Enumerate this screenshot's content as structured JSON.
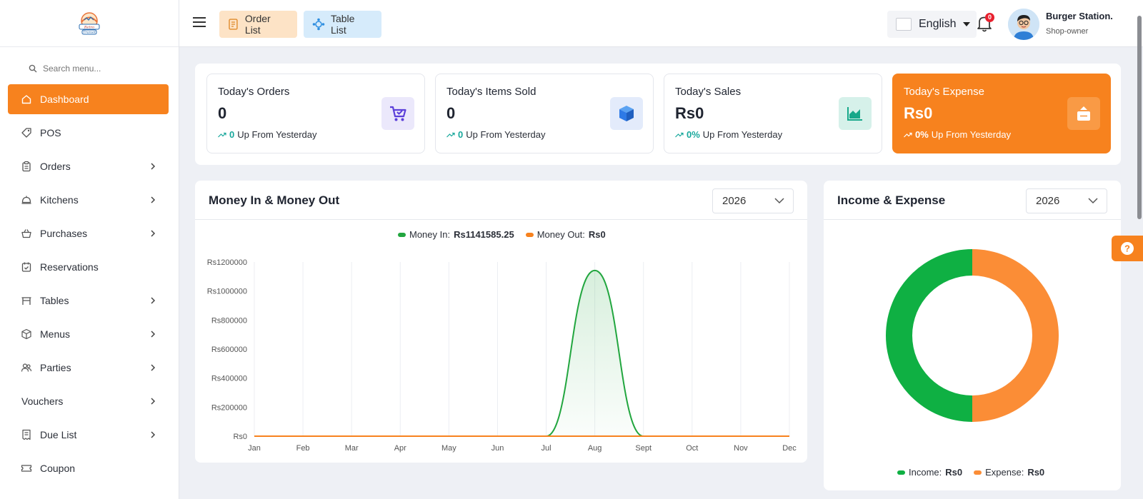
{
  "brand": {
    "logo_text": "Retro Transit"
  },
  "sidebar": {
    "search_placeholder": "Search menu...",
    "items": [
      {
        "label": "Dashboard",
        "icon": "home-icon",
        "active": true,
        "has_children": false
      },
      {
        "label": "POS",
        "icon": "tag-icon",
        "has_children": false
      },
      {
        "label": "Orders",
        "icon": "clipboard-icon",
        "has_children": true
      },
      {
        "label": "Kitchens",
        "icon": "cloche-icon",
        "has_children": true
      },
      {
        "label": "Purchases",
        "icon": "basket-icon",
        "has_children": true
      },
      {
        "label": "Reservations",
        "icon": "calendar-check-icon",
        "has_children": false
      },
      {
        "label": "Tables",
        "icon": "table-icon",
        "has_children": true
      },
      {
        "label": "Menus",
        "icon": "box-icon",
        "has_children": true
      },
      {
        "label": "Parties",
        "icon": "users-icon",
        "has_children": true
      },
      {
        "label": "Vouchers",
        "icon": "",
        "has_children": true
      },
      {
        "label": "Due List",
        "icon": "receipt-icon",
        "has_children": true
      },
      {
        "label": "Coupon",
        "icon": "ticket-icon",
        "has_children": false
      }
    ]
  },
  "header": {
    "order_list": "Order List",
    "table_list": "Table List",
    "language": "English",
    "notification_count": "0",
    "user_name": "Burger Station.",
    "user_role": "Shop-owner"
  },
  "stats": [
    {
      "title": "Today's Orders",
      "value": "0",
      "change": "0",
      "suffix": "Up From Yesterday",
      "icon": "cart-icon",
      "icon_bg": "#ebe8fb",
      "icon_color": "#5b3fd9"
    },
    {
      "title": "Today's Items Sold",
      "value": "0",
      "change": "0",
      "suffix": "Up From Yesterday",
      "icon": "cube-icon",
      "icon_bg": "#e3ebfb",
      "icon_color": "#2e7ae6"
    },
    {
      "title": "Today's Sales",
      "value": "Rs0",
      "change": "0%",
      "suffix": "Up From Yesterday",
      "icon": "area-chart-icon",
      "icon_bg": "#d6f1ea",
      "icon_color": "#17a88a"
    },
    {
      "title": "Today's Expense",
      "value": "Rs0",
      "change": "0%",
      "suffix": "Up From Yesterday",
      "icon": "expense-icon",
      "icon_bg": "#f99a45",
      "icon_color": "#ffffff"
    }
  ],
  "money_chart": {
    "year": "2026",
    "legend_in_label": "Money In:",
    "legend_in_value": "Rs1141585.25",
    "legend_out_label": "Money Out:",
    "legend_out_value": "Rs0"
  },
  "income_chart": {
    "year": "2026",
    "legend_income_label": "Income:",
    "legend_income_value": "Rs0",
    "legend_expense_label": "Expense:",
    "legend_expense_value": "Rs0"
  },
  "chart_data": [
    {
      "type": "area",
      "title": "Money In & Money Out",
      "xlabel": "",
      "ylabel": "",
      "categories": [
        "Jan",
        "Feb",
        "Mar",
        "Apr",
        "May",
        "Jun",
        "Jul",
        "Aug",
        "Sept",
        "Oct",
        "Nov",
        "Dec"
      ],
      "series": [
        {
          "name": "Money In",
          "color": "#22a63f",
          "values": [
            0,
            0,
            0,
            0,
            0,
            0,
            0,
            1141585.25,
            0,
            0,
            0,
            0
          ]
        },
        {
          "name": "Money Out",
          "color": "#f7821e",
          "values": [
            0,
            0,
            0,
            0,
            0,
            0,
            0,
            0,
            0,
            0,
            0,
            0
          ]
        }
      ],
      "ylim": [
        0,
        1200000
      ],
      "yticks": [
        "Rs0",
        "Rs200000",
        "Rs400000",
        "Rs600000",
        "Rs800000",
        "Rs1000000",
        "Rs1200000"
      ],
      "grid": "vertical",
      "legend": "top-center"
    },
    {
      "type": "pie",
      "title": "Income & Expense",
      "style": "donut",
      "series": [
        {
          "name": "Income",
          "color": "#0fb043",
          "share": 0.5
        },
        {
          "name": "Expense",
          "color": "#fb8d36",
          "share": 0.5
        }
      ],
      "legend": "bottom-center"
    }
  ]
}
